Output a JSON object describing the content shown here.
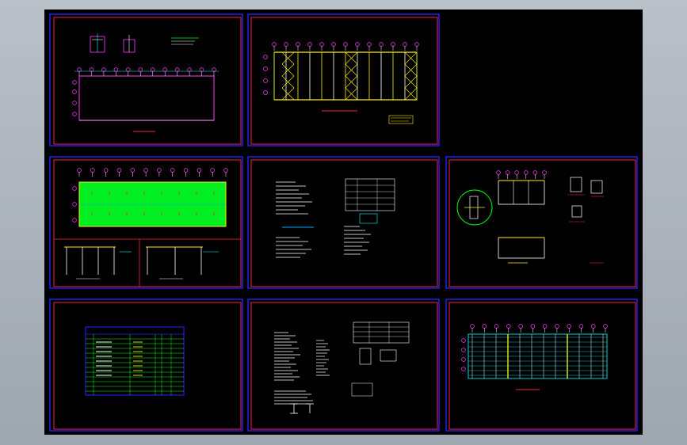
{
  "viewport": {
    "width": 867,
    "height": 562
  },
  "colors": {
    "background": "#a7aeb8",
    "canvas": "#000000",
    "sheet_border": "#2323ff",
    "frame": "#ff2040",
    "grid_bubble": "#ff3cff",
    "steel": "#ffee00",
    "dimension": "#00ffff",
    "slab_fill": "#00ee22",
    "text_white": "#ffffff"
  },
  "drawing": {
    "sheet_count": 8,
    "sheets": [
      {
        "id": "sheet-1",
        "content": "foundation-plan"
      },
      {
        "id": "sheet-2",
        "content": "elevation-bracing"
      },
      {
        "id": "sheet-3",
        "content": "roof-plan-sections"
      },
      {
        "id": "sheet-4",
        "content": "design-notes"
      },
      {
        "id": "sheet-5",
        "content": "node-details"
      },
      {
        "id": "sheet-6",
        "content": "drawing-index-table"
      },
      {
        "id": "sheet-7",
        "content": "material-notes"
      },
      {
        "id": "sheet-8",
        "content": "purlin-layout"
      }
    ]
  }
}
